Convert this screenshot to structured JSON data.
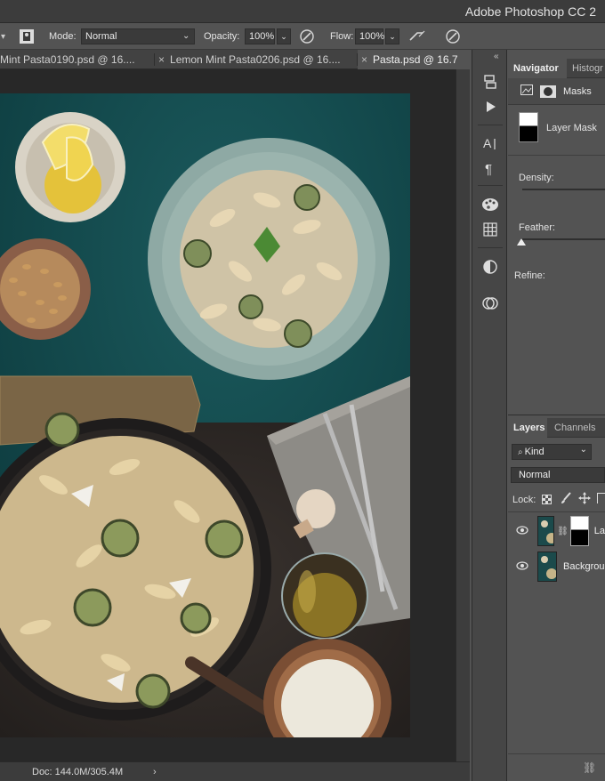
{
  "app": {
    "title": "Adobe Photoshop CC 2"
  },
  "options": {
    "mode_label": "Mode:",
    "mode_value": "Normal",
    "opacity_label": "Opacity:",
    "opacity_value": "100%",
    "flow_label": "Flow:",
    "flow_value": "100%"
  },
  "tabs": [
    {
      "label": "Mint Pasta0190.psd @ 16....",
      "active": false
    },
    {
      "label": "Lemon Mint Pasta0206.psd @ 16....",
      "active": false
    },
    {
      "label": "Pasta.psd @ 16.7",
      "active": true
    }
  ],
  "status": {
    "doc": "Doc: 144.0M/305.4M",
    "arrow": "›"
  },
  "properties": {
    "tab_navigator": "Navigator",
    "tab_histogram": "Histogr",
    "section": "Masks",
    "layer_mask": "Layer Mask",
    "density": "Density:",
    "feather": "Feather:",
    "refine": "Refine:"
  },
  "layers": {
    "tab_layers": "Layers",
    "tab_channels": "Channels",
    "filter_kind": "Kind",
    "blend": "Normal",
    "lock": "Lock:",
    "items": [
      {
        "name": "La"
      },
      {
        "name": "Backgrou"
      }
    ]
  },
  "colors": {
    "panel_bg": "#535353",
    "titlebar": "#3c3c3c",
    "canvas_bg": "#282828",
    "teal": "#13464a"
  }
}
